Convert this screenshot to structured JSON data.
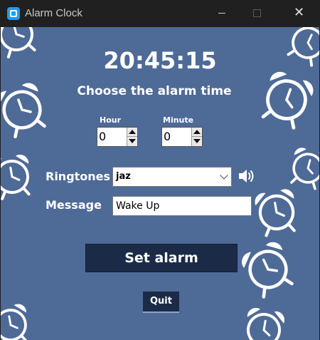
{
  "window": {
    "title": "Alarm Clock",
    "minimize_icon": "minimize-icon",
    "maximize_icon": "maximize-icon",
    "close_icon": "close-icon",
    "close_glyph": "✕"
  },
  "colors": {
    "background": "#4e6a97",
    "button": "#1b2b47",
    "titlebar": "#202020",
    "text": "#ffffff"
  },
  "main": {
    "current_time": "20:45:15",
    "heading": "Choose the alarm time",
    "hour_label": "Hour",
    "hour_value": "0",
    "minute_label": "Minute",
    "minute_value": "0",
    "ringtones_label": "Ringtones",
    "ringtone_selected": "jaz",
    "speaker_icon": "speaker-icon",
    "message_label": "Message",
    "message_value": "Wake Up",
    "set_alarm_label": "Set alarm",
    "quit_label": "Quit"
  }
}
